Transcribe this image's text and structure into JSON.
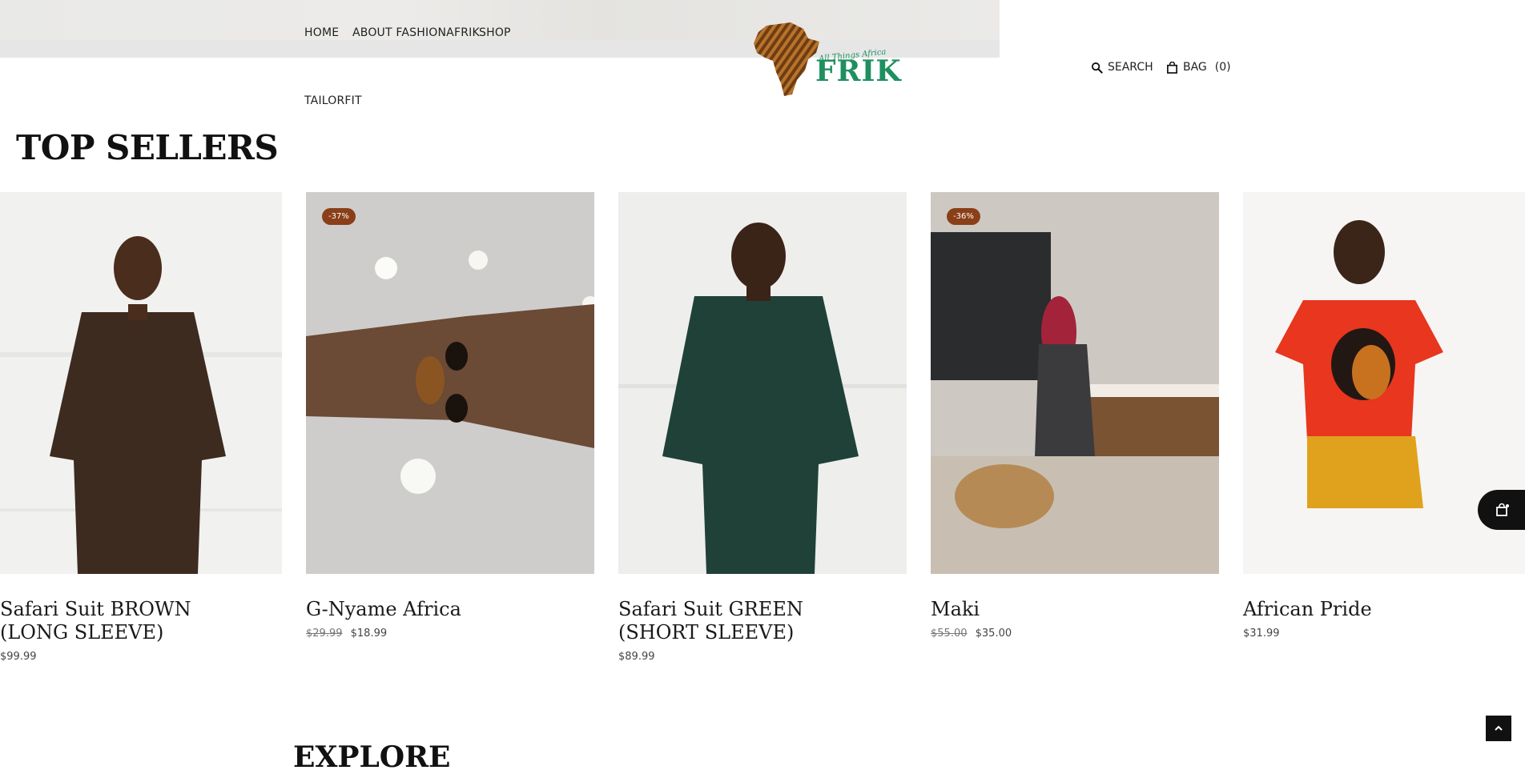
{
  "nav": {
    "items": [
      "HOME",
      "ABOUT FASHIONAFRIK",
      "SHOP",
      "TAILORFIT"
    ]
  },
  "logo": {
    "script_text": "All Things Africa",
    "brand_text": "FRIK"
  },
  "utility": {
    "search_label": "SEARCH",
    "bag_label": "BAG",
    "bag_count": "(0)"
  },
  "section": {
    "title": "TOP SELLERS",
    "next_title": "EXPLORE"
  },
  "products": [
    {
      "name": "Safari Suit BROWN (LONG SLEEVE)",
      "badge": "",
      "old_price": "",
      "price": "$99.99"
    },
    {
      "name": "G-Nyame Africa",
      "badge": "-37%",
      "old_price": "$29.99",
      "price": "$18.99"
    },
    {
      "name": "Safari Suit GREEN (SHORT SLEEVE)",
      "badge": "",
      "old_price": "",
      "price": "$89.99"
    },
    {
      "name": "Maki",
      "badge": "-36%",
      "old_price": "$55.00",
      "price": "$35.00"
    },
    {
      "name": "African Pride",
      "badge": "",
      "old_price": "",
      "price": "$31.99"
    }
  ],
  "colors": {
    "badge_bg": "#8a3f18",
    "brand_green": "#1f8f5f"
  },
  "icons": {
    "search": "search-icon",
    "bag": "bag-icon",
    "cart_float": "cart-icon",
    "back_to_top": "chevron-up-icon"
  }
}
